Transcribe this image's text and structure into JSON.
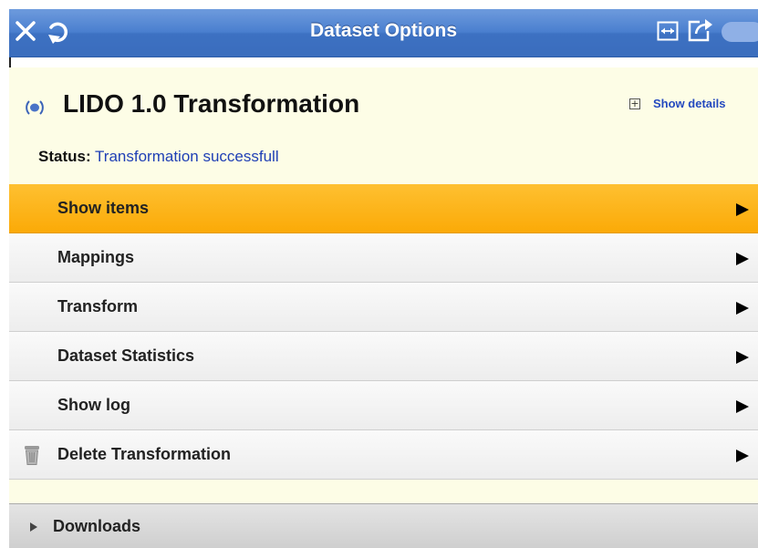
{
  "titlebar": {
    "title": "Dataset Options",
    "left_icons": [
      "close-icon",
      "refresh-icon"
    ],
    "right_icons": [
      "expand-icon",
      "share-icon"
    ]
  },
  "dataset": {
    "title": "LIDO 1.0 Transformation",
    "details_link": "Show details",
    "status_label": "Status:",
    "status_value": "Transformation successfull"
  },
  "menu": [
    {
      "label": "Show items",
      "active": true
    },
    {
      "label": "Mappings"
    },
    {
      "label": "Transform"
    },
    {
      "label": "Dataset Statistics"
    },
    {
      "label": "Show log"
    },
    {
      "label": "Delete Transformation",
      "icon": "trash-icon"
    }
  ],
  "downloads": {
    "label": "Downloads"
  },
  "colors": {
    "titlebar": "#4a7fcf",
    "active_item": "#fbaa07",
    "header_bg": "#fdfde6",
    "link": "#2449bf"
  }
}
